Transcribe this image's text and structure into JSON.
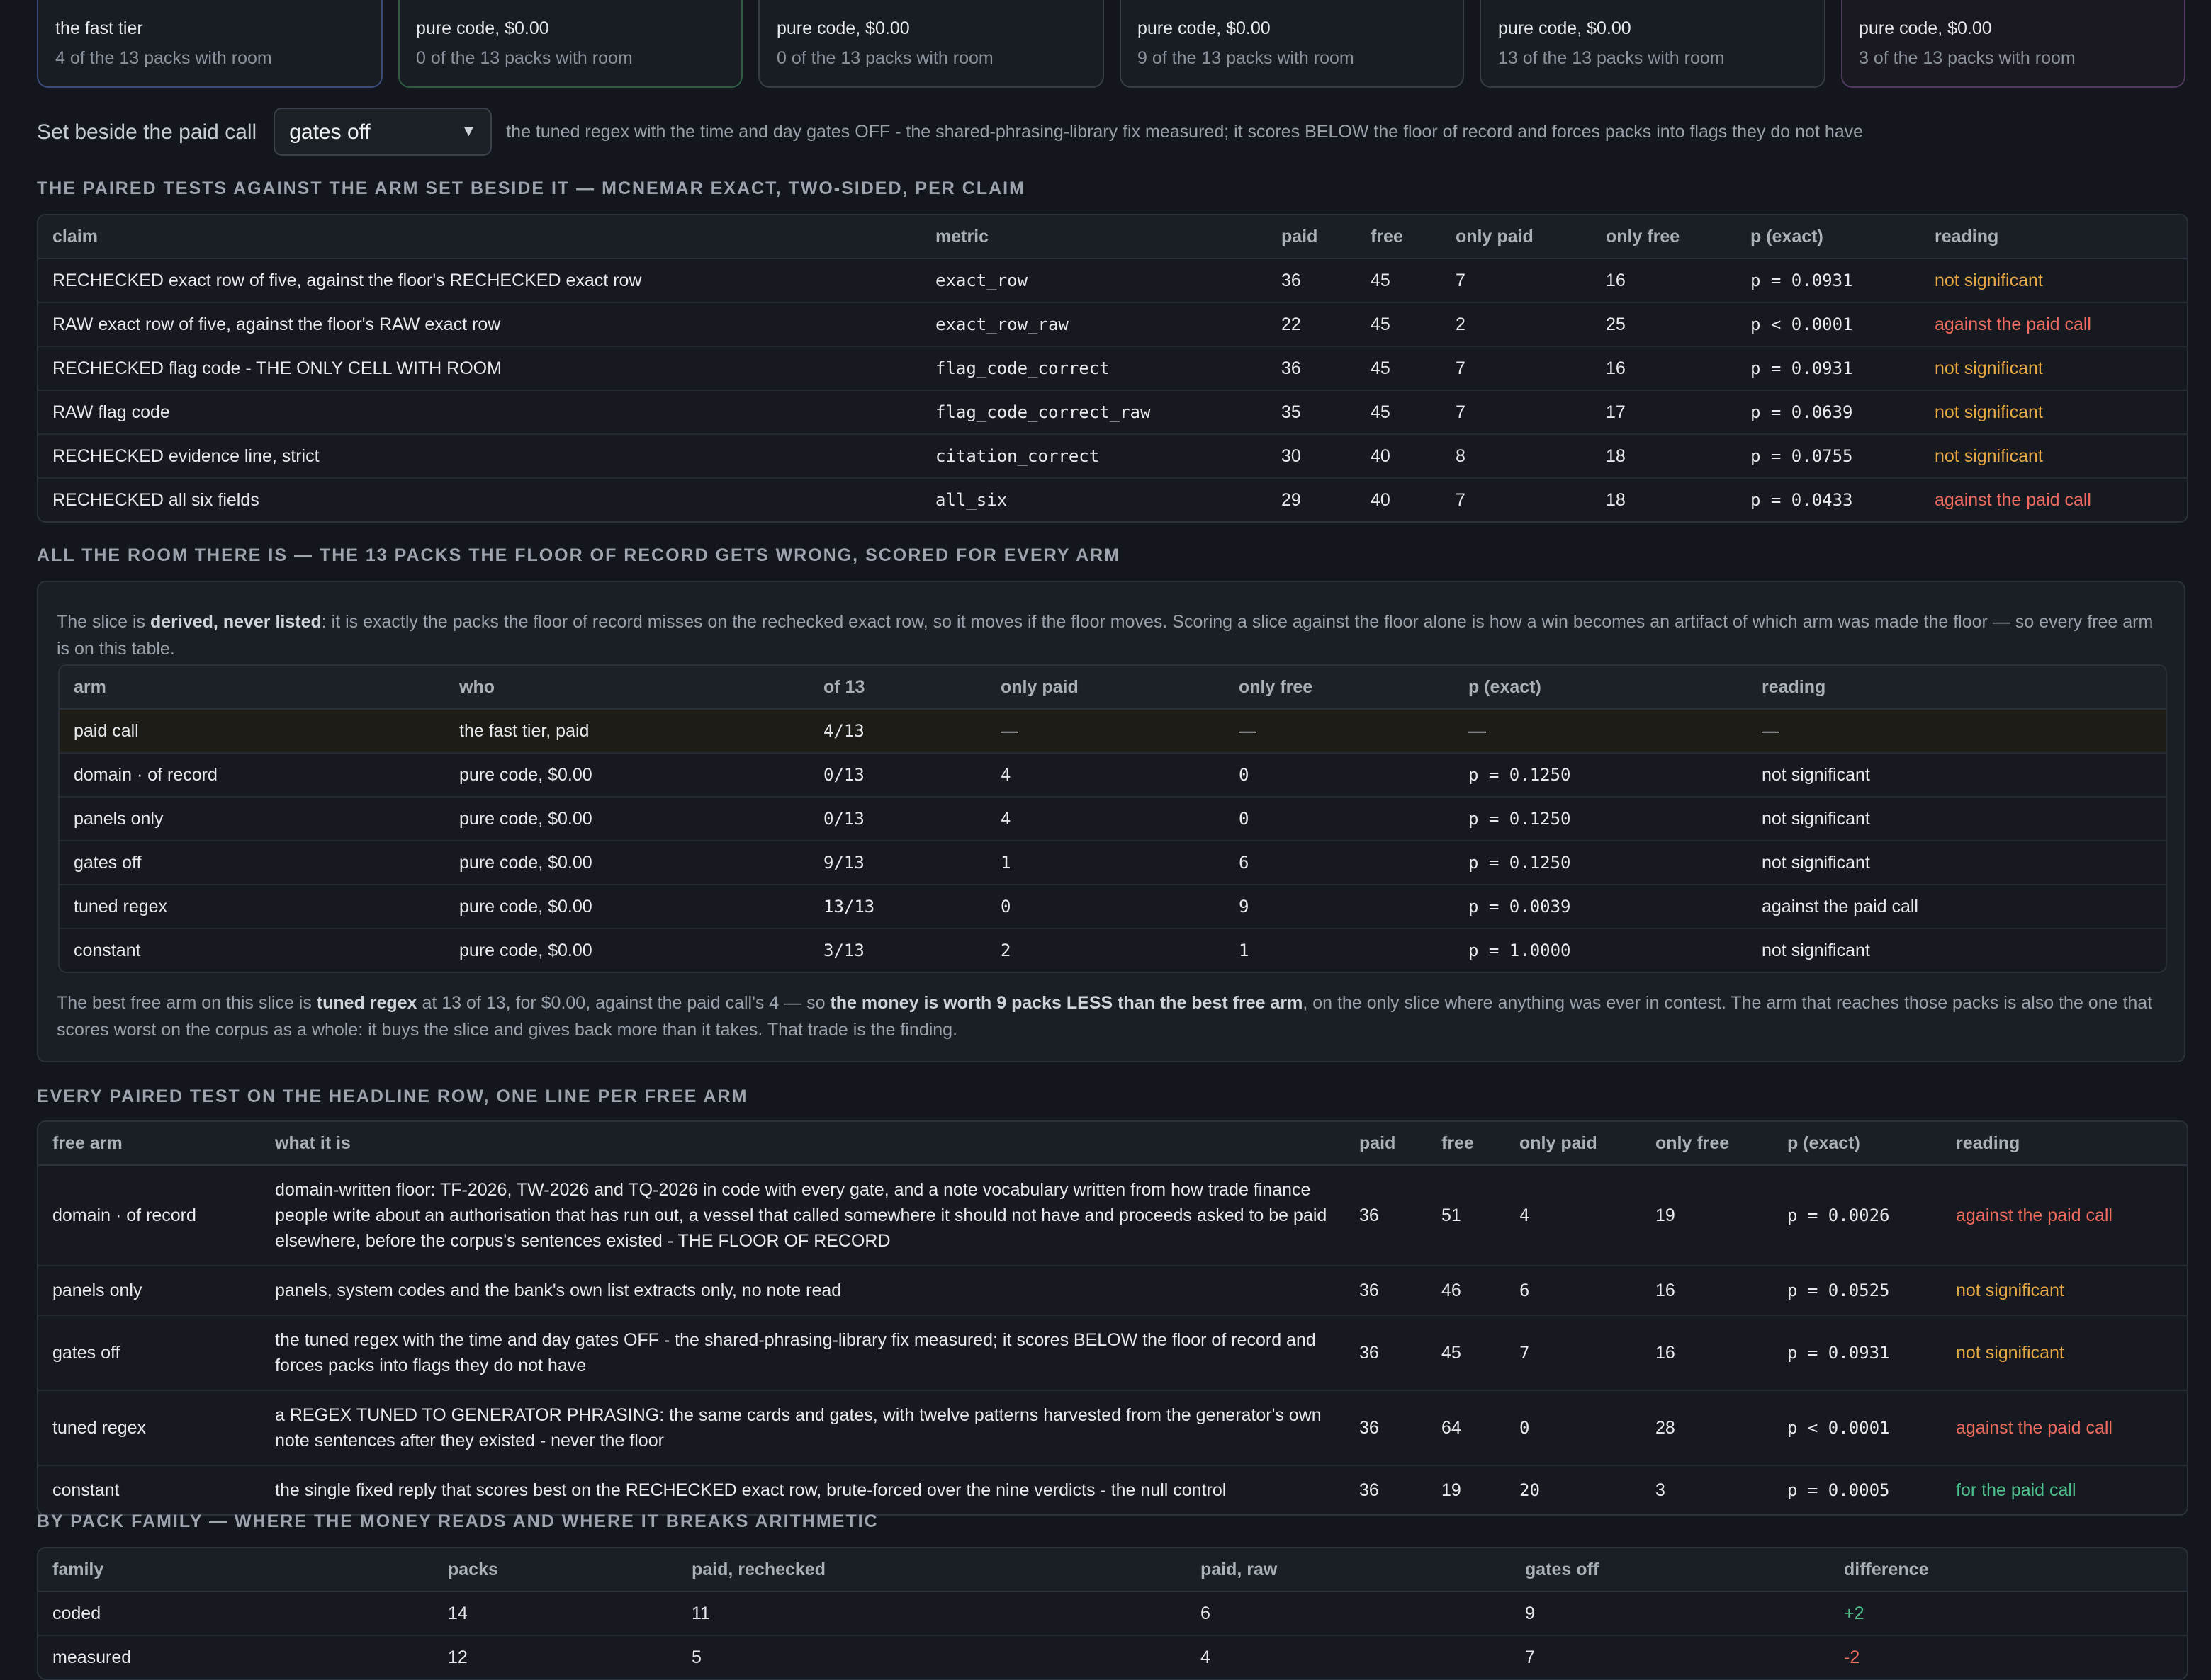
{
  "cards": [
    {
      "line1": "the fast tier",
      "line2": "4 of the 13 packs with room"
    },
    {
      "line1": "pure code, $0.00",
      "line2": "0 of the 13 packs with room"
    },
    {
      "line1": "pure code, $0.00",
      "line2": "0 of the 13 packs with room"
    },
    {
      "line1": "pure code, $0.00",
      "line2": "9 of the 13 packs with room"
    },
    {
      "line1": "pure code, $0.00",
      "line2": "13 of the 13 packs with room"
    },
    {
      "line1": "pure code, $0.00",
      "line2": "3 of the 13 packs with room"
    }
  ],
  "selector": {
    "label": "Set beside the paid call",
    "value": "gates off",
    "description": "the tuned regex with the time and day gates OFF - the shared-phrasing-library fix measured; it scores BELOW the floor of record and forces packs into flags they do not have"
  },
  "paired": {
    "heading": "THE PAIRED TESTS AGAINST THE ARM SET BESIDE IT — MCNEMAR EXACT, TWO-SIDED, PER CLAIM",
    "columns": [
      "claim",
      "metric",
      "paid",
      "free",
      "only paid",
      "only free",
      "p (exact)",
      "reading"
    ],
    "rows": [
      [
        "RECHECKED exact row of five, against the floor's RECHECKED exact row",
        "exact_row",
        "36",
        "45",
        "7",
        "16",
        "p = 0.0931",
        "not significant"
      ],
      [
        "RAW exact row of five, against the floor's RAW exact row",
        "exact_row_raw",
        "22",
        "45",
        "2",
        "25",
        "p < 0.0001",
        "against the paid call"
      ],
      [
        "RECHECKED flag code - THE ONLY CELL WITH ROOM",
        "flag_code_correct",
        "36",
        "45",
        "7",
        "16",
        "p = 0.0931",
        "not significant"
      ],
      [
        "RAW flag code",
        "flag_code_correct_raw",
        "35",
        "45",
        "7",
        "17",
        "p = 0.0639",
        "not significant"
      ],
      [
        "RECHECKED evidence line, strict",
        "citation_correct",
        "30",
        "40",
        "8",
        "18",
        "p = 0.0755",
        "not significant"
      ],
      [
        "RECHECKED all six fields",
        "all_six",
        "29",
        "40",
        "7",
        "18",
        "p = 0.0433",
        "against the paid call"
      ]
    ]
  },
  "room": {
    "heading": "ALL THE ROOM THERE IS — THE 13 PACKS THE FLOOR OF RECORD GETS WRONG, SCORED FOR EVERY ARM",
    "intro_a": "The slice is ",
    "intro_b": "derived, never listed",
    "intro_c": ": it is exactly the packs the floor of record misses on the rechecked exact row, so it moves if the floor moves. Scoring a slice against the floor alone is how a win becomes an artifact of which arm was made the floor — so every free arm is on this table.",
    "columns": [
      "arm",
      "who",
      "of 13",
      "only paid",
      "only free",
      "p (exact)",
      "reading"
    ],
    "rows": [
      [
        "paid call",
        "the fast tier, paid",
        "4/13",
        "—",
        "—",
        "—",
        "—"
      ],
      [
        "domain · of record",
        "pure code, $0.00",
        "0/13",
        "4",
        "0",
        "p = 0.1250",
        "not significant"
      ],
      [
        "panels only",
        "pure code, $0.00",
        "0/13",
        "4",
        "0",
        "p = 0.1250",
        "not significant"
      ],
      [
        "gates off",
        "pure code, $0.00",
        "9/13",
        "1",
        "6",
        "p = 0.1250",
        "not significant"
      ],
      [
        "tuned regex",
        "pure code, $0.00",
        "13/13",
        "0",
        "9",
        "p = 0.0039",
        "against the paid call"
      ],
      [
        "constant",
        "pure code, $0.00",
        "3/13",
        "2",
        "1",
        "p = 1.0000",
        "not significant"
      ]
    ],
    "outro_a": "The best free arm on this slice is ",
    "outro_b": "tuned regex",
    "outro_c": " at 13 of 13, for $0.00, against the paid call's 4 — so ",
    "outro_d": "the money is worth 9 packs LESS than the best free arm",
    "outro_e": ", on the only slice where anything was ever in contest. The arm that reaches those packs is also the one that scores worst on the corpus as a whole: it buys the slice and gives back more than it takes. That trade is the finding."
  },
  "headline": {
    "heading": "EVERY PAIRED TEST ON THE HEADLINE ROW, ONE LINE PER FREE ARM",
    "columns": [
      "free arm",
      "what it is",
      "paid",
      "free",
      "only paid",
      "only free",
      "p (exact)",
      "reading"
    ],
    "rows": [
      [
        "domain · of record",
        "domain-written floor: TF-2026, TW-2026 and TQ-2026 in code with every gate, and a note vocabulary written from how trade finance people write about an authorisation that has run out, a vessel that called somewhere it should not have and proceeds asked to be paid elsewhere, before the corpus's sentences existed - THE FLOOR OF RECORD",
        "36",
        "51",
        "4",
        "19",
        "p = 0.0026",
        "against the paid call"
      ],
      [
        "panels only",
        "panels, system codes and the bank's own list extracts only, no note read",
        "36",
        "46",
        "6",
        "16",
        "p = 0.0525",
        "not significant"
      ],
      [
        "gates off",
        "the tuned regex with the time and day gates OFF - the shared-phrasing-library fix measured; it scores BELOW the floor of record and forces packs into flags they do not have",
        "36",
        "45",
        "7",
        "16",
        "p = 0.0931",
        "not significant"
      ],
      [
        "tuned regex",
        "a REGEX TUNED TO GENERATOR PHRASING: the same cards and gates, with twelve patterns harvested from the generator's own note sentences after they existed - never the floor",
        "36",
        "64",
        "0",
        "28",
        "p < 0.0001",
        "against the paid call"
      ],
      [
        "constant",
        "the single fixed reply that scores best on the RECHECKED exact row, brute-forced over the nine verdicts - the null control",
        "36",
        "19",
        "20",
        "3",
        "p = 0.0005",
        "for the paid call"
      ]
    ]
  },
  "family": {
    "heading": "BY PACK FAMILY — WHERE THE MONEY READS AND WHERE IT BREAKS ARITHMETIC",
    "columns": [
      "family",
      "packs",
      "paid, rechecked",
      "paid, raw",
      "gates off",
      "difference"
    ],
    "rows": [
      [
        "coded",
        "14",
        "11",
        "6",
        "9",
        "+2"
      ],
      [
        "measured",
        "12",
        "5",
        "4",
        "7",
        "-2"
      ]
    ]
  },
  "colors": {
    "not_significant": "#e6a845",
    "against": "#ee6b5e",
    "for": "#4fc08d"
  }
}
